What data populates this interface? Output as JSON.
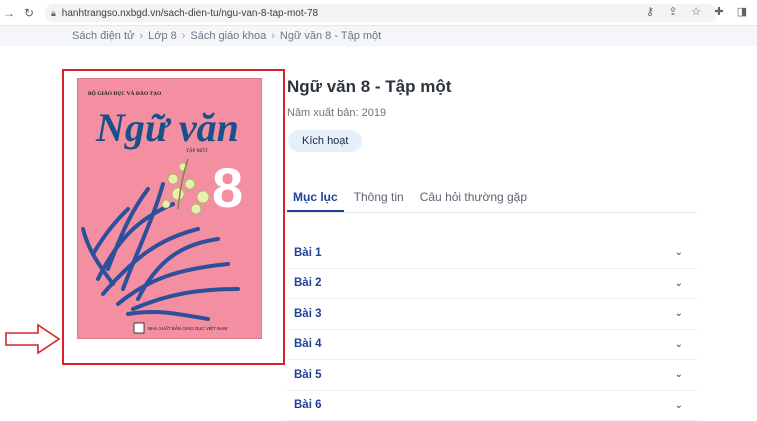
{
  "browser": {
    "url": "hanhtrangso.nxbgd.vn/sach-dien-tu/ngu-van-8-tap-mot-78"
  },
  "breadcrumb": {
    "items": [
      "Sách điện tử",
      "Lớp 8",
      "Sách giáo khoa",
      "Ngữ văn 8 - Tập một"
    ]
  },
  "cover": {
    "publisher_top": "BỘ GIÁO DỤC VÀ ĐÀO TẠO",
    "subject": "Ngữ văn",
    "volume": "TẬP MỘT",
    "grade": "8",
    "publisher_bottom": "NHÀ XUẤT BẢN GIÁO DỤC VIỆT NAM"
  },
  "book": {
    "title": "Ngữ văn 8 - Tập một",
    "year_label": "Năm xuất bản: 2019",
    "activate_label": "Kích hoạt"
  },
  "tabs": [
    {
      "label": "Mục lục",
      "active": true
    },
    {
      "label": "Thông tin",
      "active": false
    },
    {
      "label": "Câu hỏi thường gặp",
      "active": false
    }
  ],
  "lessons": [
    "Bài 1",
    "Bài 2",
    "Bài 3",
    "Bài 4",
    "Bài 5",
    "Bài 6"
  ],
  "colors": {
    "accent": "#1f3f9a",
    "highlight_border": "#d8232a",
    "cover_bg": "#f38fa1"
  }
}
